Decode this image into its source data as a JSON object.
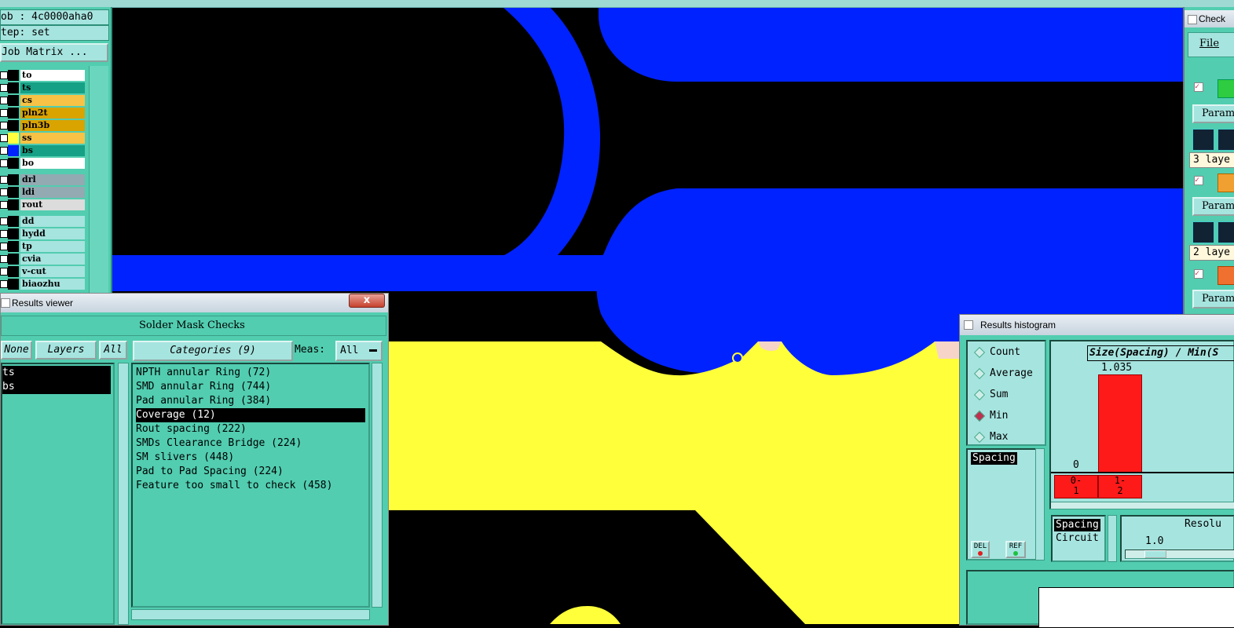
{
  "left_panel": {
    "job": "ob : 4c0000aha0",
    "step": "tep: set",
    "matrix_button": "Job Matrix ...",
    "layers": [
      {
        "name": "to",
        "color": "#ffffff"
      },
      {
        "name": "ts",
        "color": "#16a085"
      },
      {
        "name": "cs",
        "color": "#f7c245"
      },
      {
        "name": "pln2t",
        "color": "#d9a300"
      },
      {
        "name": "pln3b",
        "color": "#d9a300"
      },
      {
        "name": "ss",
        "color": "#f7c245"
      },
      {
        "name": "bs",
        "color": "#16a085"
      },
      {
        "name": "bo",
        "color": "#ffffff"
      },
      {
        "name": "drl",
        "color": "#93aab2"
      },
      {
        "name": "ldi",
        "color": "#93aab2"
      },
      {
        "name": "rout",
        "color": "#dcdcdc"
      },
      {
        "name": "dd",
        "color": "#a6e4df"
      },
      {
        "name": "hydd",
        "color": "#a6e4df"
      },
      {
        "name": "tp",
        "color": "#a6e4df"
      },
      {
        "name": "cvia",
        "color": "#a6e4df"
      },
      {
        "name": "v-cut",
        "color": "#a6e4df"
      },
      {
        "name": "biaozhu",
        "color": "#a6e4df"
      }
    ]
  },
  "results_viewer": {
    "title": "Results viewer",
    "close": "x",
    "heading": "Solder Mask Checks",
    "none_btn": "None",
    "layers_btn": "Layers",
    "all_btn": "All",
    "categories_btn": "Categories (9)",
    "meas_label": "Meas:",
    "meas_value": "All",
    "layer_items": [
      "ts",
      "bs"
    ],
    "categories": [
      "NPTH annular Ring (72)",
      "SMD annular Ring (744)",
      "Pad annular Ring (384)",
      "Coverage (12)",
      "Rout spacing (222)",
      "SMDs Clearance Bridge (224)",
      "SM slivers (448)",
      "Pad to Pad Spacing (224)",
      "Feature too small to check (458)"
    ]
  },
  "results_histogram": {
    "title": "Results histogram",
    "options": [
      "Count",
      "Average",
      "Sum",
      "Min",
      "Max"
    ],
    "selected_option": "Min",
    "measure_list": [
      "Spacing"
    ],
    "del_btn": "DEL",
    "ref_btn": "REF",
    "chart_title": "Size(Spacing) / Min(S",
    "bar_label": "1.035",
    "zero_label": "0",
    "bins": [
      "0-\n1",
      "1-\n2"
    ],
    "lower_list": [
      "Spacing",
      "Circuit"
    ],
    "resolution_label": "Resolu",
    "resolution_value": "1.0"
  },
  "checklist": {
    "title": "Check",
    "menu_file": "File",
    "param1": "Param",
    "layers1": "3 laye",
    "param2": "Param",
    "layers2": "2 laye",
    "param3": "Param"
  }
}
